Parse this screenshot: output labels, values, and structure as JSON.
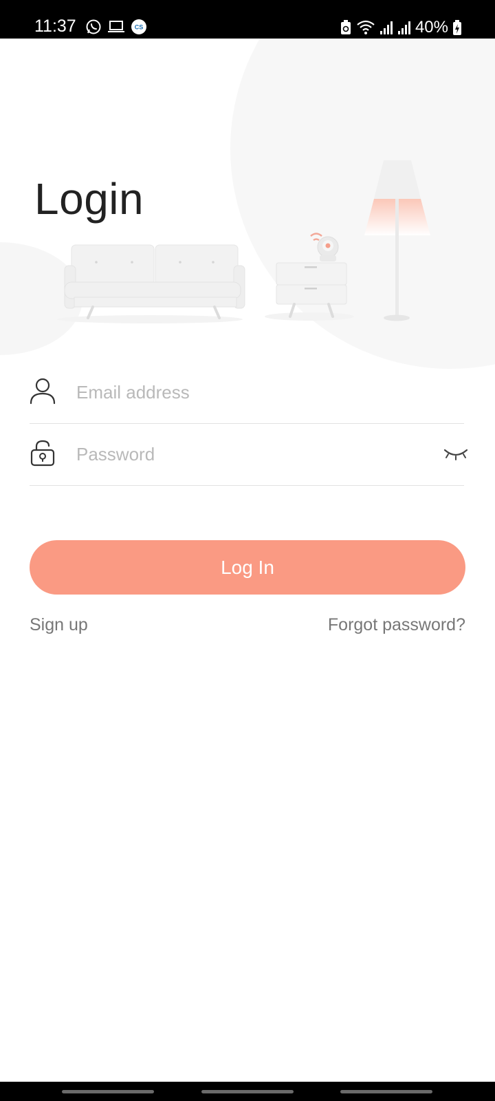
{
  "status_bar": {
    "time": "11:37",
    "left_icons": [
      "whatsapp-icon",
      "laptop-icon",
      "app-badge-icon"
    ],
    "app_badge_text": "CS",
    "right_icons": [
      "battery-saver-icon",
      "wifi-icon",
      "signal-icon",
      "signal-icon"
    ],
    "battery_percent": "40%"
  },
  "login": {
    "title": "Login",
    "email": {
      "placeholder": "Email address",
      "value": "",
      "icon": "user-icon"
    },
    "password": {
      "placeholder": "Password",
      "value": "",
      "icon": "lock-icon",
      "toggle_icon": "eye-closed-icon"
    },
    "submit_label": "Log In",
    "signup_label": "Sign up",
    "forgot_label": "Forgot password?"
  },
  "colors": {
    "accent": "#fa9a83",
    "placeholder": "#b9b9b9",
    "link": "#777777",
    "divider": "#e2e2e2"
  }
}
